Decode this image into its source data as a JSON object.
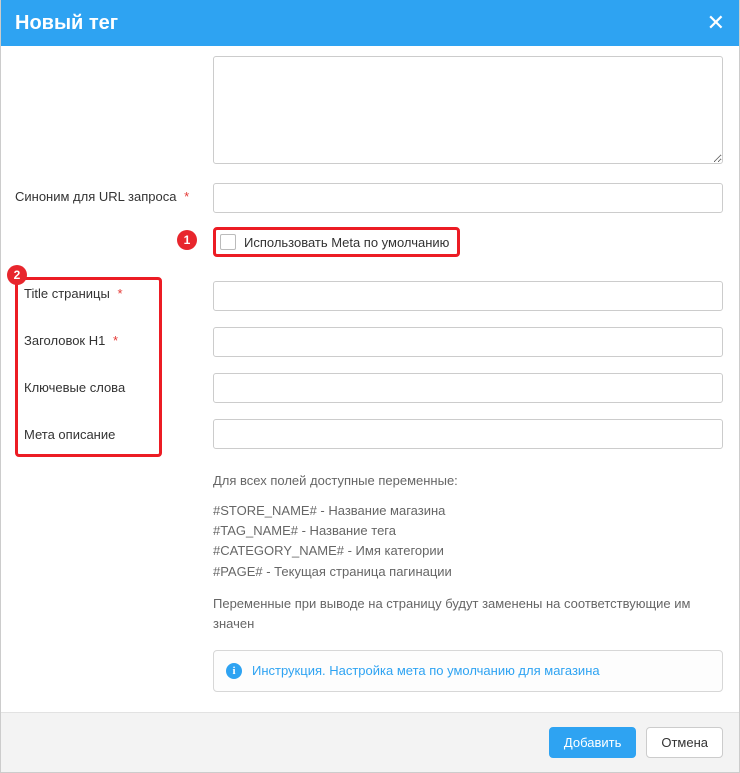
{
  "header": {
    "title": "Новый тег"
  },
  "callouts": {
    "one": "1",
    "two": "2"
  },
  "form": {
    "url_synonym_label": "Синоним для URL запроса",
    "use_default_meta_label": "Использовать Meta по умолчанию",
    "title_label": "Title страницы",
    "h1_label": "Заголовок H1",
    "keywords_label": "Ключевые слова",
    "meta_desc_label": "Мета описание"
  },
  "notes": {
    "intro": "Для всех полей доступные переменные:",
    "vars": [
      "#STORE_NAME# - Название магазина",
      "#TAG_NAME# - Название тега",
      "#CATEGORY_NAME# - Имя категории",
      "#PAGE# - Текущая страница пагинации"
    ],
    "outro": "Переменные при выводе на страницу будут заменены на соответствующие им значен"
  },
  "info_link": "Инструкция. Настройка мета по умолчанию для магазина",
  "buttons": {
    "add": "Добавить",
    "cancel": "Отмена"
  }
}
